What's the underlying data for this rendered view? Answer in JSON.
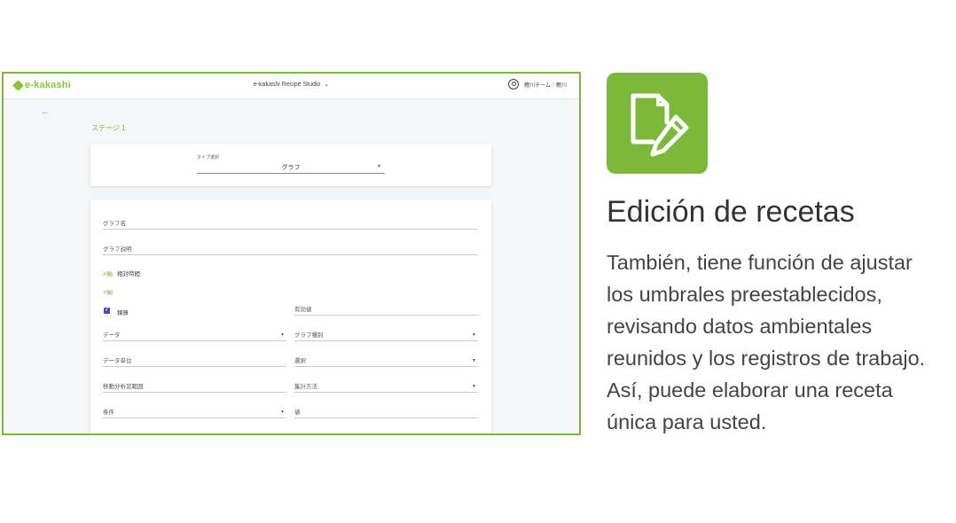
{
  "app": {
    "logo_text": "e-kakashi",
    "studio_title": "e-kakashi Recipe Studio",
    "user_label": "鰹川チーム｜鰹川"
  },
  "stage": {
    "back_icon": "←",
    "title": "ステージ 1"
  },
  "type_select": {
    "label": "タイプ選択",
    "value": "グラフ"
  },
  "form": {
    "graph_name": "グラフ名",
    "graph_desc": "グラフ説明",
    "x_axis_label": "X軸",
    "x_axis_value": "相対時間",
    "y_axis_label": "Y軸",
    "checkbox_label": "積算",
    "valid_value": "有効値",
    "data": "データ",
    "graph_type": "グラフ種別",
    "data_unit": "データ単位",
    "select": "選択",
    "moving_range": "移動分析窓範囲",
    "agg_method": "集計方法",
    "condition": "条件",
    "value": "値"
  },
  "panel": {
    "icon": "edit-document-icon",
    "heading": "Edición de recetas",
    "lines": [
      "También, tiene función de ajustar",
      "los umbrales preestablecidos,",
      "revisando datos ambientales",
      "reunidos y los registros de trabajo.",
      "Así, puede elaborar una receta",
      "única para usted."
    ]
  },
  "colors": {
    "accent": "#7cb83a",
    "checkbox": "#3f51b5"
  }
}
